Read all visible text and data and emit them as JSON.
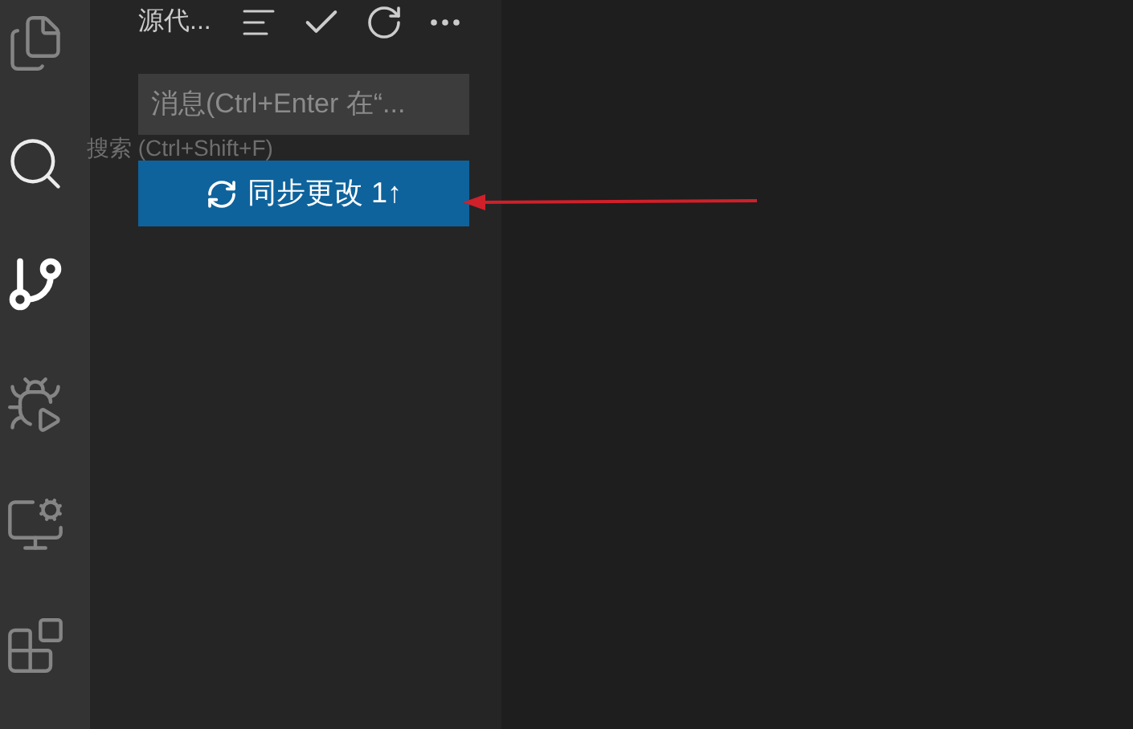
{
  "activity_bar": {
    "items": [
      {
        "kind": "files",
        "selected": false,
        "hovered": false
      },
      {
        "kind": "search",
        "selected": false,
        "hovered": true
      },
      {
        "kind": "source-control",
        "selected": true,
        "hovered": false
      },
      {
        "kind": "run-debug",
        "selected": false,
        "hovered": false
      },
      {
        "kind": "remote",
        "selected": false,
        "hovered": false
      },
      {
        "kind": "extensions",
        "selected": false,
        "hovered": false
      }
    ]
  },
  "tooltip": "搜索 (Ctrl+Shift+F)",
  "sidebar": {
    "title": "源代...",
    "message_field": {
      "placeholder": "消息(Ctrl+Enter 在“..."
    },
    "sync_button": "同步更改 1↑"
  }
}
